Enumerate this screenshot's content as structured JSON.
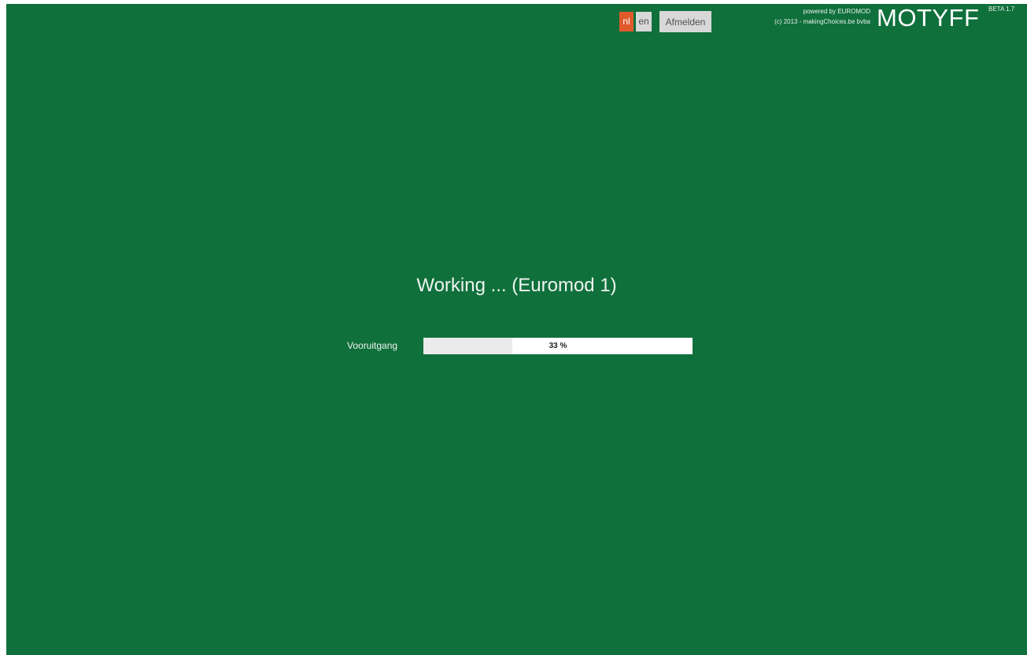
{
  "header": {
    "languages": [
      {
        "code": "nl",
        "label": "nl",
        "active": true
      },
      {
        "code": "en",
        "label": "en",
        "active": false
      }
    ],
    "logout_label": "Afmelden",
    "powered_by": "powered by EUROMOD",
    "copyright": "(c) 2013 - makingChoices.be bvba",
    "brand": "MOTYFF",
    "version": "BETA 1.7"
  },
  "main": {
    "status_title": "Working ... (Euromod 1)",
    "progress": {
      "label": "Vooruitgang",
      "value_text": "33 %",
      "fraction": 0.33
    }
  },
  "colors": {
    "background": "#10703c",
    "active_language": "#e05a2b",
    "button": "#d8d8d8",
    "progress_fill": "#ebebeb",
    "progress_track": "#ffffff"
  }
}
